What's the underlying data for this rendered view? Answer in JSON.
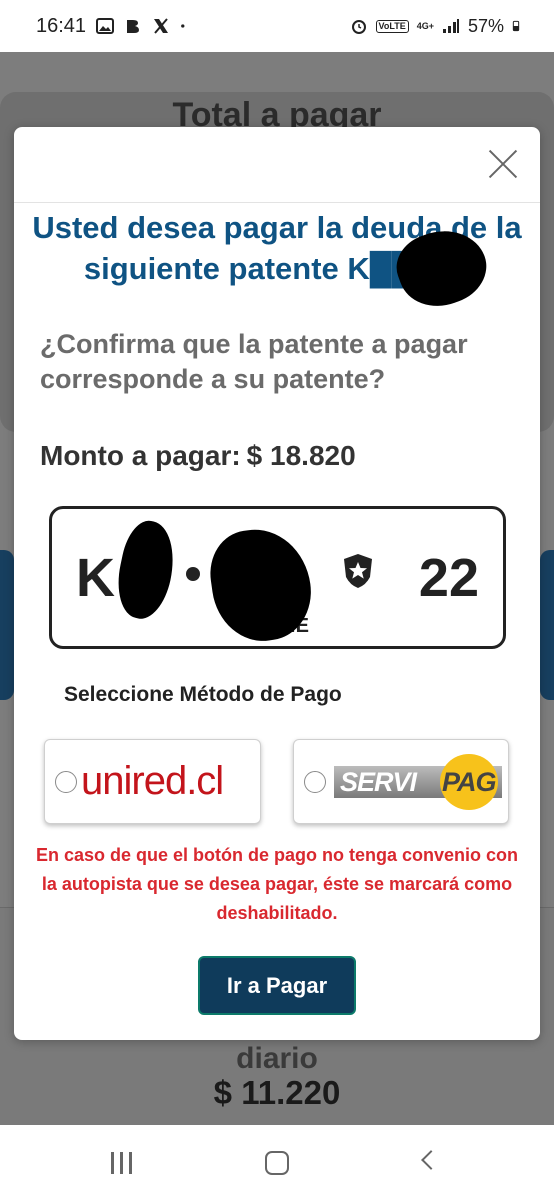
{
  "status_bar": {
    "time": "16:41",
    "net_tag": "VoLTE",
    "net_type": "4G+",
    "battery": "57%"
  },
  "background": {
    "heading": "Total a pagar",
    "amount": "$ 11.220",
    "partial_text": "diario"
  },
  "modal": {
    "title": "Usted desea pagar la deuda de la siguiente patente K███22",
    "question": "¿Confirma que la patente a pagar corresponde a su patente?",
    "amount_label": "Monto a pagar:",
    "amount_value": "$ 18.820",
    "plate": {
      "letters": "K",
      "number": "22",
      "country": "CHILE"
    },
    "method_label": "Seleccione Método de Pago",
    "options": [
      {
        "name": "unired.cl",
        "selected": false
      },
      {
        "name_left": "SERVI",
        "name_right": "PAG",
        "selected": false
      }
    ],
    "warning": "En caso de que el botón de pago no tenga convenio con la autopista que se desea pagar, éste se marcará como deshabilitado.",
    "go_button": "Ir a Pagar"
  },
  "colors": {
    "title_blue": "#0f5383",
    "warning_red": "#d9282f",
    "button_navy": "#0f3b5b",
    "unired_red": "#c3141b",
    "servipag_yellow": "#f7c21b"
  }
}
